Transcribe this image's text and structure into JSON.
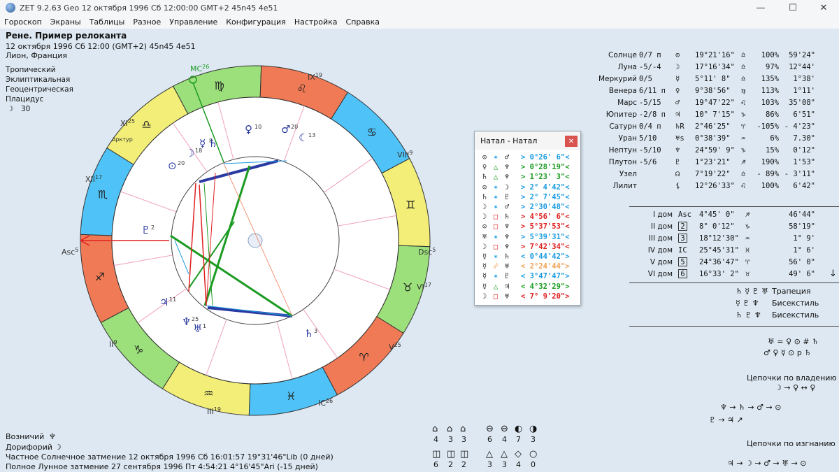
{
  "window": {
    "title": "ZET 9.2.63 Geo   12 октября 1996  Сб  12:00:00 GMT+2 45n45  4e51",
    "minimize": "—",
    "maximize": "☐",
    "close": "✕"
  },
  "menu": [
    "Гороскоп",
    "Экраны",
    "Таблицы",
    "Разное",
    "Управление",
    "Конфигурация",
    "Настройка",
    "Справка"
  ],
  "info": {
    "name": "Рене. Пример релоканта",
    "date": "12 октября 1996  Сб  12:00 (GMT+2) 45n45  4e51",
    "place": "Лион, Франция",
    "zodiac": "Тропический",
    "coords": "Эклиптикальная",
    "center": "Геоцентрическая",
    "houses": "Плацидус",
    "moon_glyph": "☽",
    "moon_value": "30"
  },
  "chart_labels": {
    "mc": "MC",
    "mc_deg": "26",
    "ic": "IC",
    "ic_deg": "26",
    "asc": "Asc",
    "asc_deg": "5",
    "dsc": "Dsc",
    "dsc_deg": "5",
    "cusp_ix": "IX",
    "cusp_ix_deg": "19",
    "cusp_viii": "VIII",
    "cusp_viii_deg": "9",
    "cusp_xi": "XI",
    "cusp_xi_deg": "25",
    "cusp_xii": "XII",
    "cusp_xii_deg": "17",
    "cusp_ii": "II",
    "cusp_ii_deg": "9",
    "cusp_iii": "III",
    "cusp_iii_deg": "19",
    "cusp_v": "V",
    "cusp_v_deg": "25",
    "cusp_vi": "VI",
    "cusp_vi_deg": "17",
    "arcturus": "Арктур"
  },
  "signs": [
    {
      "glyph": "♍",
      "color": "#9be07a"
    },
    {
      "glyph": "♌",
      "color": "#f07a55"
    },
    {
      "glyph": "♋",
      "color": "#4fc3f7"
    },
    {
      "glyph": "♊",
      "color": "#f2ee78"
    },
    {
      "glyph": "♉",
      "color": "#9be07a"
    },
    {
      "glyph": "♈",
      "color": "#f07a55"
    },
    {
      "glyph": "♓",
      "color": "#4fc3f7"
    },
    {
      "glyph": "♒",
      "color": "#f2ee78"
    },
    {
      "glyph": "♑",
      "color": "#9be07a"
    },
    {
      "glyph": "♐",
      "color": "#f07a55"
    },
    {
      "glyph": "♏",
      "color": "#4fc3f7"
    },
    {
      "glyph": "♎",
      "color": "#f2ee78"
    }
  ],
  "chart_planets": [
    {
      "glyph": "♀",
      "num": "10"
    },
    {
      "glyph": "♂",
      "num": "20"
    },
    {
      "glyph": "☾",
      "num": "13"
    },
    {
      "glyph": "☽",
      "num": "18"
    },
    {
      "glyph": "☿",
      "num": "8"
    },
    {
      "glyph": "♄",
      "num": ""
    },
    {
      "glyph": "⊙",
      "num": "20"
    },
    {
      "glyph": "♇",
      "num": "2"
    },
    {
      "glyph": "♃",
      "num": "11"
    },
    {
      "glyph": "♆",
      "num": "25"
    },
    {
      "glyph": "♅",
      "num": "1"
    },
    {
      "glyph": "♄",
      "num": "3"
    }
  ],
  "planets": [
    {
      "name": "Солнце",
      "pos": "0/7 п",
      "glyph": "⊙",
      "lon": "19°21'16\"",
      "sign": "♎",
      "pct": "100%",
      "speed": "59'24\""
    },
    {
      "name": "Луна",
      "pos": "-5/-4",
      "glyph": "☽",
      "lon": "17°16'34\"",
      "sign": "♎",
      "pct": "97%",
      "speed": "12°44'"
    },
    {
      "name": "Меркурий",
      "pos": "0/5",
      "glyph": "☿",
      "lon": "5°11' 8\"",
      "sign": "♎",
      "pct": "135%",
      "speed": "1°38'"
    },
    {
      "name": "Венера",
      "pos": "6/11 п",
      "glyph": "♀",
      "lon": "9°38'56\"",
      "sign": "♍",
      "pct": "113%",
      "speed": "1°11'"
    },
    {
      "name": "Марс",
      "pos": "-5/15",
      "glyph": "♂",
      "lon": "19°47'22\"",
      "sign": "♌",
      "pct": "103%",
      "speed": "35'08\""
    },
    {
      "name": "Юпитер",
      "pos": "-2/8 п",
      "glyph": "♃",
      "lon": "10° 7'15\"",
      "sign": "♑",
      "pct": "86%",
      "speed": "6'51\""
    },
    {
      "name": "Сатурн",
      "pos": "0/4 п",
      "glyph": "♄R",
      "lon": "2°46'25\"",
      "sign": "♈",
      "pct": "-105%",
      "speed": "- 4'23\""
    },
    {
      "name": "Уран",
      "pos": "5/10",
      "glyph": "♅s",
      "lon": "0°38'39\"",
      "sign": "♒",
      "pct": "6%",
      "speed": "7.30\""
    },
    {
      "name": "Нептун",
      "pos": "-5/10",
      "glyph": "♆",
      "lon": "24°59' 9\"",
      "sign": "♑",
      "pct": "15%",
      "speed": "0'12\""
    },
    {
      "name": "Плутон",
      "pos": "-5/6",
      "glyph": "♇",
      "lon": "1°23'21\"",
      "sign": "♐",
      "pct": "190%",
      "speed": "1'53\""
    },
    {
      "name": "Узел",
      "pos": "",
      "glyph": "☊",
      "lon": "7°19'22\"",
      "sign": "♎",
      "pct": "- 89%",
      "speed": "- 3'11\""
    },
    {
      "name": "Лилит",
      "pos": "",
      "glyph": "⚸",
      "lon": "12°26'33\"",
      "sign": "♌",
      "pct": "100%",
      "speed": "6'42\""
    }
  ],
  "houses": [
    {
      "name": "I дом",
      "mark": "Asc",
      "lon": "4°45' 0\"",
      "sign": "♐",
      "size": "46'44\""
    },
    {
      "name": "II дом",
      "mark": "2",
      "lon": "8° 0'12\"",
      "sign": "♑",
      "size": "58'19\""
    },
    {
      "name": "III дом",
      "mark": "3",
      "lon": "18°12'30\"",
      "sign": "♒",
      "size": "1° 9'"
    },
    {
      "name": "IV дом",
      "mark": "IC",
      "lon": "25°45'31\"",
      "sign": "♓",
      "size": "1° 6'"
    },
    {
      "name": "V дом",
      "mark": "5",
      "lon": "24°36'47\"",
      "sign": "♈",
      "size": "56' 0\""
    },
    {
      "name": "VI дом",
      "mark": "6",
      "lon": "16°33' 2\"",
      "sign": "♉",
      "size": "49' 6\""
    }
  ],
  "config": [
    {
      "glyphs": "♄ ☿ ♇ ♅",
      "name": "Трапеция"
    },
    {
      "glyphs": "☿ ♇ ♆",
      "name": "Бисекстиль"
    },
    {
      "glyphs": "♄ ♇ ♆",
      "name": "Бисекстиль"
    }
  ],
  "receptions": [
    "♅ = ♀ ⊙ # ♄",
    "♂ ♀ ☿ ⊙ p ♄"
  ],
  "chains_own": {
    "title": "Цепочки по владению",
    "line1": "☽ → ♀ ↔ ♀",
    "line2": "♆ → ♄ → ♂ → ⊙",
    "line3": "♇ → ♃ ↗"
  },
  "chains_exile": {
    "title": "Цепочки по изгнанию",
    "line1": "♃ → ☽ → ♂ → ♅ → ⊙"
  },
  "aspect_window": {
    "title": "Натал - Натал",
    "rows": [
      {
        "a": "⊙",
        "asp": "✶",
        "b": "♂",
        "val": "> 0°26' 6\"<",
        "color": "#1a9be0"
      },
      {
        "a": "♀",
        "asp": "△",
        "b": "♆",
        "val": "> 0°28'19\"<",
        "color": "#1c9b22"
      },
      {
        "a": "♄",
        "asp": "△",
        "b": "♆",
        "val": "> 1°23' 3\"<",
        "color": "#1c9b22"
      },
      {
        "a": "⊙",
        "asp": "✶",
        "b": "☽",
        "val": "> 2° 4'42\"<",
        "color": "#1a9be0"
      },
      {
        "a": "♄",
        "asp": "✶",
        "b": "♇",
        "val": "> 2° 7'45\"<",
        "color": "#1a9be0"
      },
      {
        "a": "☽",
        "asp": "✶",
        "b": "♂",
        "val": "> 2°30'48\"<",
        "color": "#1a9be0"
      },
      {
        "a": "☽",
        "asp": "□",
        "b": "♄",
        "val": "> 4°56' 6\"<",
        "color": "#e02020"
      },
      {
        "a": "⊙",
        "asp": "□",
        "b": "♆",
        "val": "> 5°37'53\"<",
        "color": "#e02020"
      },
      {
        "a": "♅",
        "asp": "✶",
        "b": "♆",
        "val": "> 5°39'31\"<",
        "color": "#1a9be0"
      },
      {
        "a": "☽",
        "asp": "□",
        "b": "♆",
        "val": "> 7°42'34\"<",
        "color": "#e02020"
      },
      {
        "a": "☿",
        "asp": "✶",
        "b": "♄",
        "val": "< 0°44'42\">",
        "color": "#1a9be0"
      },
      {
        "a": "☿",
        "asp": "☍",
        "b": "♅",
        "val": "< 2°24'44\">",
        "color": "#f0a050"
      },
      {
        "a": "☿",
        "asp": "✶",
        "b": "♇",
        "val": "< 3°47'47\">",
        "color": "#1a9be0"
      },
      {
        "a": "☿",
        "asp": "△",
        "b": "♃",
        "val": "< 4°32'29\">",
        "color": "#1c9b22"
      },
      {
        "a": "☽",
        "asp": "□",
        "b": "♅",
        "val": "< 7° 9'20\">",
        "color": "#e02020"
      }
    ]
  },
  "bottom": {
    "vozn_label": "Возничий",
    "vozn_glyph": "♆",
    "dor_label": "Дорифорий",
    "dor_glyph": "☽",
    "eclipse1": "Частное Солнечное затмение 12 октября 1996 Сб 16:01:57 19°31'46\"Lib (0 дней)",
    "eclipse2": "Полное Лунное затмение 27 сентября 1996 Пт  4:54:21  4°16'45\"Ari (-15 дней)"
  },
  "shape_stats": [
    {
      "icon": "⌂",
      "value": "4"
    },
    {
      "icon": "⌂",
      "value": "3"
    },
    {
      "icon": "⌂",
      "value": "3"
    },
    {
      "icon": "⊖",
      "value": "6"
    },
    {
      "icon": "⊖",
      "value": "4"
    },
    {
      "icon": "◐",
      "value": "7"
    },
    {
      "icon": "◑",
      "value": "3"
    }
  ],
  "shape_stats2": [
    {
      "icon": "◫",
      "value": "6"
    },
    {
      "icon": "◫",
      "value": "2"
    },
    {
      "icon": "◫",
      "value": "2"
    },
    {
      "icon": "△",
      "value": "3"
    },
    {
      "icon": "△",
      "value": "3"
    },
    {
      "icon": "◇",
      "value": "4"
    },
    {
      "icon": "○",
      "value": "0"
    }
  ]
}
